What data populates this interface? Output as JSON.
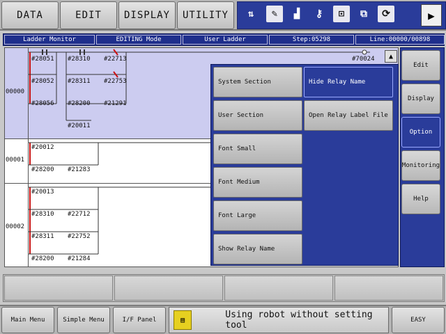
{
  "top_menu": {
    "data": "DATA",
    "edit": "EDIT",
    "display": "DISPLAY",
    "utility": "UTILITY"
  },
  "status_icons": [
    "job-icon",
    "edit-icon",
    "signal-icon",
    "key-icon",
    "robot-icon",
    "monitor-icon",
    "refresh-icon"
  ],
  "header": {
    "title": "Ladder Monitor",
    "mode": "EDITING Mode",
    "section": "User Ladder",
    "step": "Step:05298",
    "line": "Line:00000/00898"
  },
  "ladder": {
    "rungs": [
      {
        "step": "00000",
        "relays": [
          "#28051",
          "#28310",
          "#22713",
          "#28052",
          "#28311",
          "#22753",
          "#28056",
          "#28200",
          "#21291",
          "#20011"
        ],
        "output": "#70024"
      },
      {
        "step": "00001",
        "relays": [
          "#20012",
          "#28200",
          "#21283"
        ]
      },
      {
        "step": "00002",
        "relays": [
          "#20013",
          "#28310",
          "#22712",
          "#28311",
          "#22752",
          "#28200",
          "#21284"
        ]
      }
    ]
  },
  "option_menu": {
    "left": [
      "System Section",
      "User Section",
      "Font Small",
      "Font Medium",
      "Font Large",
      "Show Relay Name"
    ],
    "right": [
      "Hide Relay Name",
      "Open Relay Label File"
    ]
  },
  "side_buttons": [
    "Edit",
    "Display",
    "Option",
    "Monitoring",
    "Help"
  ],
  "bottom": {
    "main_menu": "Main Menu",
    "simple_menu": "Simple Menu",
    "if_panel": "I/F Panel",
    "message": "Using robot without setting tool",
    "mode": "EASY"
  },
  "colors": {
    "accent": "#2a3c9a",
    "selected_rung": "#ccccf0",
    "contact_red": "#cc1111"
  }
}
